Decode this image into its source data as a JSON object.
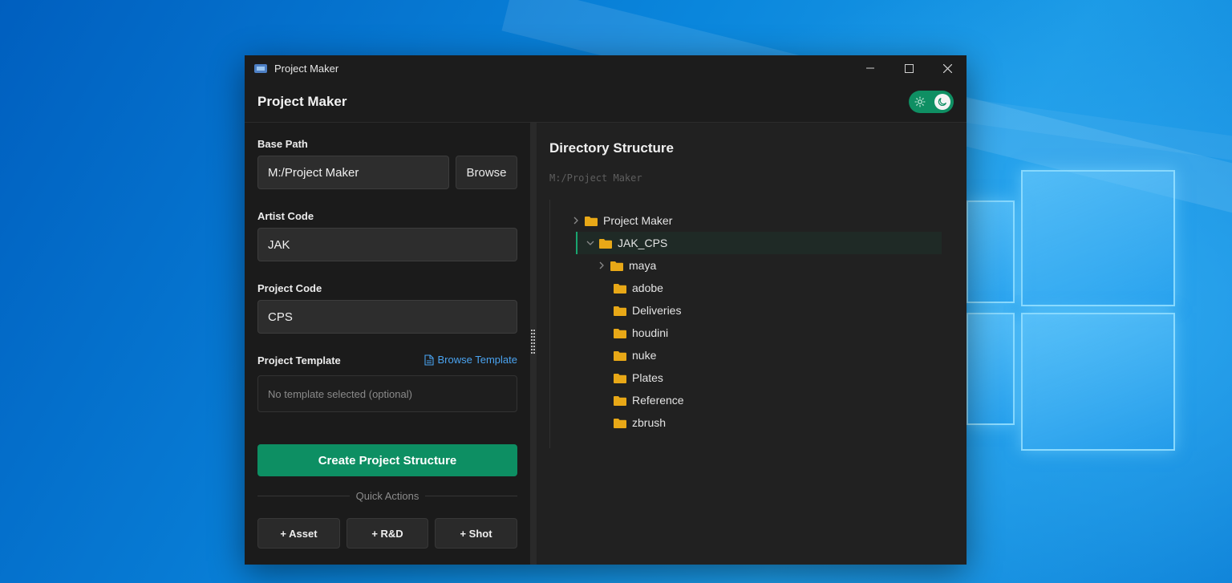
{
  "window": {
    "title": "Project Maker"
  },
  "header": {
    "title": "Project Maker"
  },
  "form": {
    "base_path": {
      "label": "Base Path",
      "value": "M:/Project Maker",
      "browse_label": "Browse"
    },
    "artist_code": {
      "label": "Artist Code",
      "value": "JAK"
    },
    "project_code": {
      "label": "Project Code",
      "value": "CPS"
    },
    "template": {
      "label": "Project Template",
      "browse_label": "Browse Template",
      "placeholder": "No template selected (optional)"
    },
    "create_label": "Create Project Structure",
    "quick_actions": {
      "label": "Quick Actions",
      "asset": "+ Asset",
      "rnd": "+ R&D",
      "shot": "+ Shot"
    }
  },
  "directory": {
    "title": "Directory Structure",
    "path": "M:/Project Maker",
    "items": [
      {
        "name": "Project Maker",
        "expanded": false
      },
      {
        "name": "JAK_CPS",
        "expanded": true,
        "selected": true
      },
      {
        "name": "maya",
        "expanded": false
      },
      {
        "name": "adobe"
      },
      {
        "name": "Deliveries"
      },
      {
        "name": "houdini"
      },
      {
        "name": "nuke"
      },
      {
        "name": "Plates"
      },
      {
        "name": "Reference"
      },
      {
        "name": "zbrush"
      }
    ]
  },
  "colors": {
    "accent": "#0d8f63",
    "link": "#4aa3f0",
    "folder": "#e8a817"
  }
}
